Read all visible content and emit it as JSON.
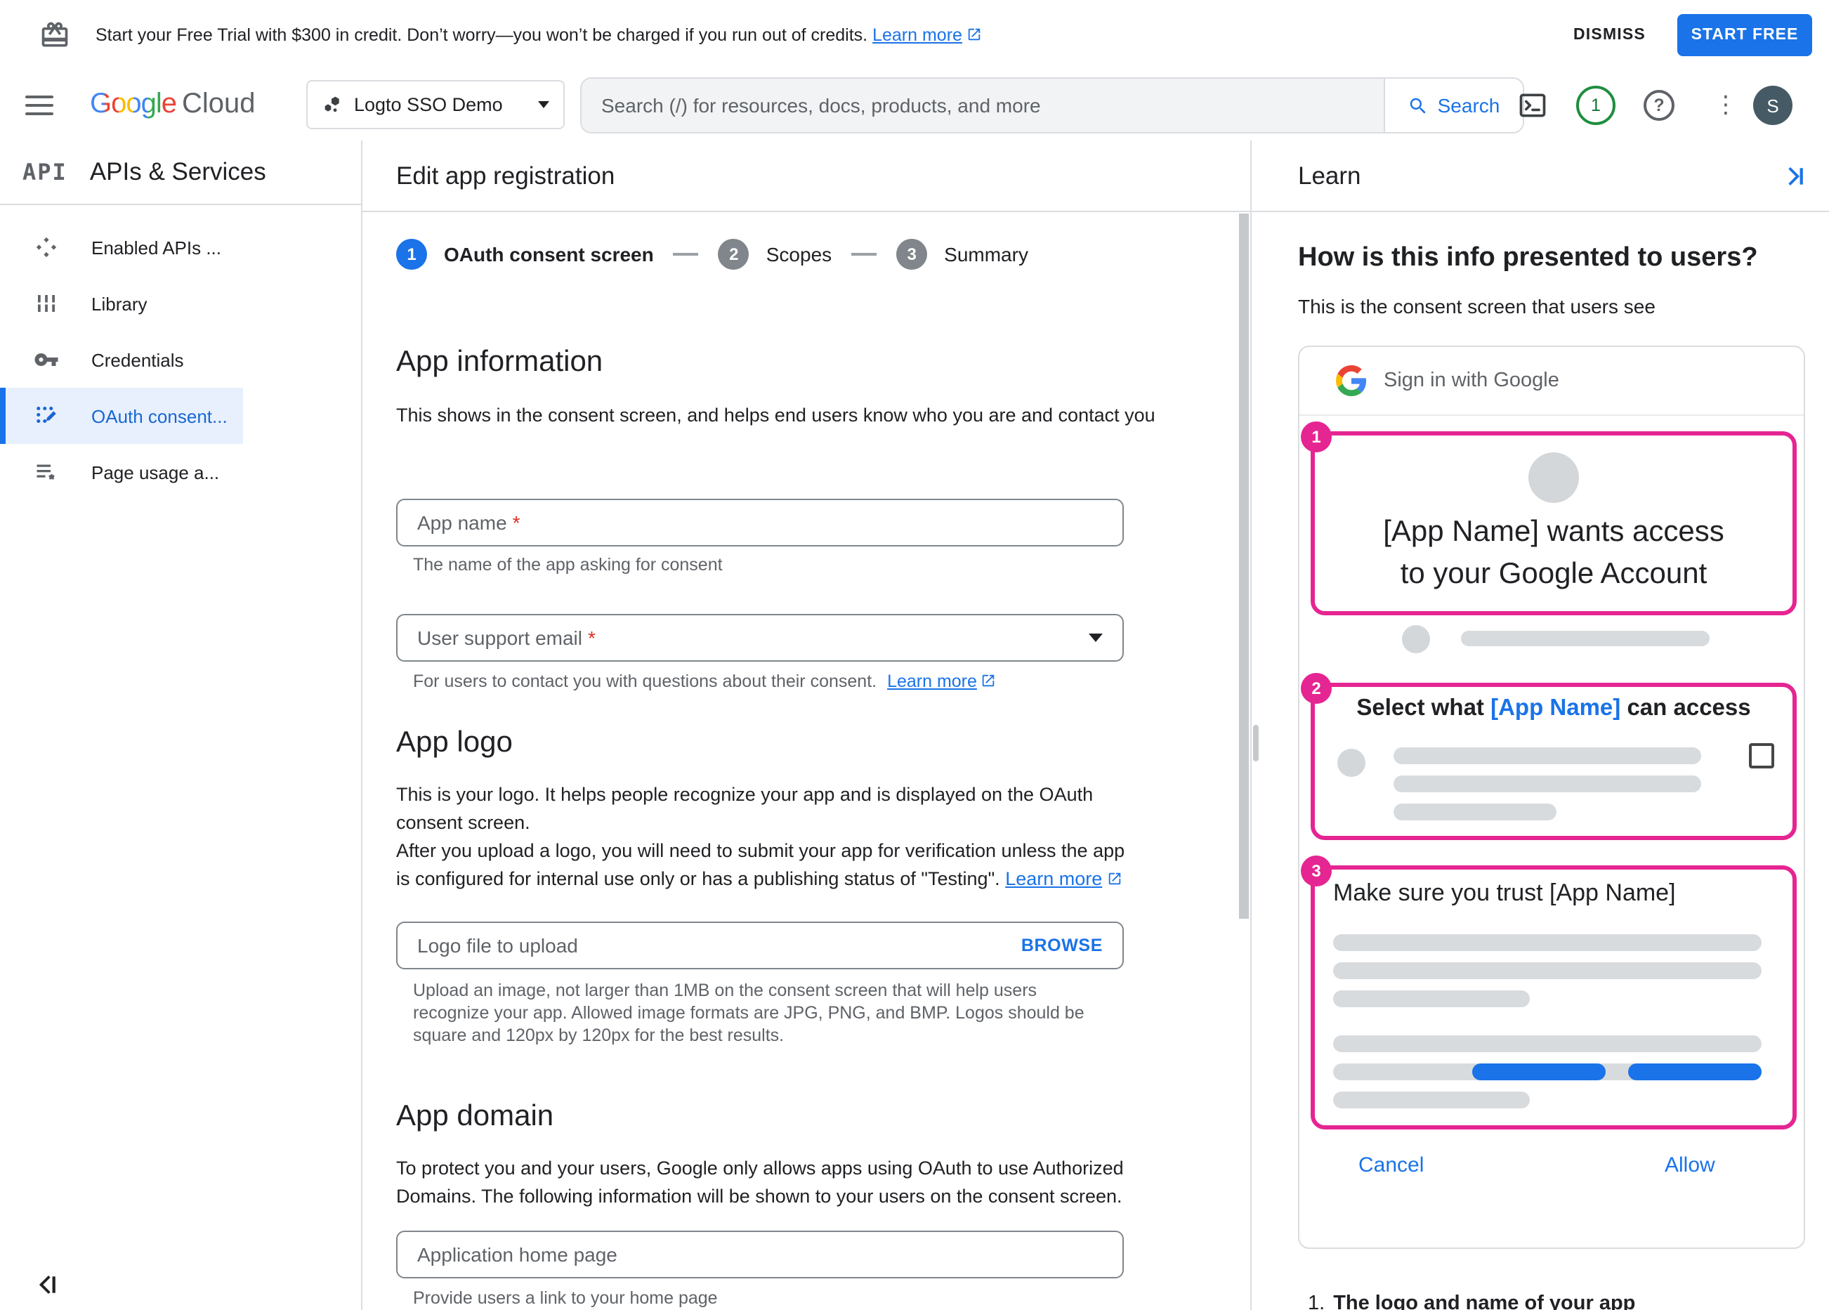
{
  "colors": {
    "accent_blue": "#1a73e8",
    "selected_blue": "#1967d2",
    "selected_bg": "#e8f0fe",
    "pink": "#e52592",
    "required_red": "#d93025",
    "green_ring": "#1e8e3e",
    "avatar_bg": "#455a64",
    "text_primary": "#202124",
    "text_secondary": "#5f6368",
    "border": "#dadce0",
    "placeholder_bar": "#d8dbde"
  },
  "banner": {
    "message": "Start your Free Trial with $300 in credit. Don’t worry—you won’t be charged if you run out of credits.",
    "learn_more": "Learn more",
    "dismiss_label": "DISMISS",
    "start_free_label": "START FREE"
  },
  "header": {
    "logo_google": "Google",
    "logo_cloud": "Cloud",
    "project_name": "Logto SSO Demo",
    "search_placeholder": "Search (/) for resources, docs, products, and more",
    "search_label": "Search",
    "notification_count": "1",
    "help_glyph": "?",
    "more_glyph": "⋮",
    "avatar_initial": "S"
  },
  "sidebar": {
    "logo": "API",
    "title": "APIs & Services",
    "items": [
      {
        "label": "Enabled APIs ..."
      },
      {
        "label": "Library"
      },
      {
        "label": "Credentials"
      },
      {
        "label": "OAuth consent..."
      },
      {
        "label": "Page usage a..."
      }
    ]
  },
  "main": {
    "title": "Edit app registration",
    "stepper": [
      {
        "num": "1",
        "label": "OAuth consent screen"
      },
      {
        "num": "2",
        "label": "Scopes"
      },
      {
        "num": "3",
        "label": "Summary"
      }
    ],
    "app_information": {
      "heading": "App information",
      "description": "This shows in the consent screen, and helps end users know who you are and contact you",
      "app_name_label": "App name",
      "app_name_required": "*",
      "app_name_helper": "The name of the app asking for consent",
      "email_label": "User support email",
      "email_required": "*",
      "email_helper": "For users to contact you with questions about their consent.",
      "email_learn_more": "Learn more"
    },
    "app_logo": {
      "heading": "App logo",
      "description_1": "This is your logo. It helps people recognize your app and is displayed on the OAuth consent screen.",
      "description_2": "After you upload a logo, you will need to submit your app for verification unless the app is configured for internal use only or has a publishing status of \"Testing\".",
      "learn_more": "Learn more",
      "upload_placeholder": "Logo file to upload",
      "browse_label": "BROWSE",
      "upload_helper": "Upload an image, not larger than 1MB on the consent screen that will help users recognize your app. Allowed image formats are JPG, PNG, and BMP. Logos should be square and 120px by 120px for the best results."
    },
    "app_domain": {
      "heading": "App domain",
      "description": "To protect you and your users, Google only allows apps using OAuth to use Authorized Domains. The following information will be shown to your users on the consent screen.",
      "home_page_placeholder": "Application home page",
      "home_page_helper": "Provide users a link to your home page"
    }
  },
  "learn_panel": {
    "title": "Learn",
    "heading": "How is this info presented to users?",
    "subheading": "This is the consent screen that users see",
    "consent_preview": {
      "signin_header": "Sign in with Google",
      "step1_badge": "1",
      "headline_line1": "[App Name] wants access",
      "headline_line2": "to your Google Account",
      "step2_badge": "2",
      "step2_prefix": "Select what ",
      "step2_app_name": "[App Name]",
      "step2_suffix": " can access",
      "step3_badge": "3",
      "step3_title": "Make sure you trust [App Name]",
      "cancel_label": "Cancel",
      "allow_label": "Allow"
    },
    "footnote_number": "1.",
    "footnote_text": "The logo and name of your app"
  }
}
